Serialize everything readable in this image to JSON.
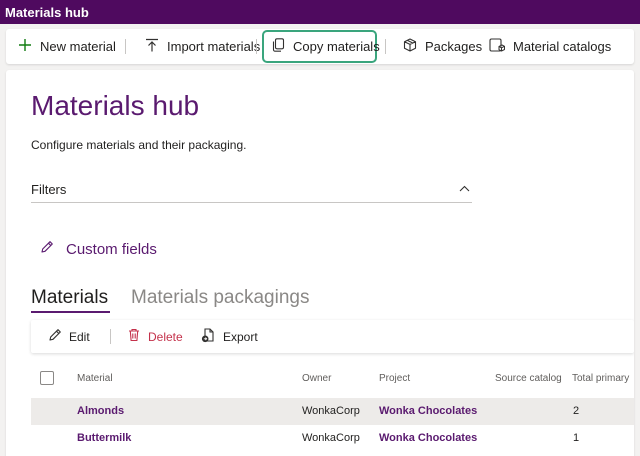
{
  "app": {
    "title": "Materials hub"
  },
  "toolbar": {
    "new_material": "New material",
    "import_materials": "Import materials",
    "copy_materials": "Copy materials",
    "packages": "Packages",
    "material_catalogs": "Material catalogs"
  },
  "page": {
    "title": "Materials hub",
    "subtitle": "Configure materials and their packaging.",
    "filters_label": "Filters",
    "custom_fields": "Custom fields"
  },
  "tabs": [
    {
      "label": "Materials",
      "active": true
    },
    {
      "label": "Materials packagings",
      "active": false
    }
  ],
  "subtoolbar": {
    "edit": "Edit",
    "delete": "Delete",
    "export": "Export"
  },
  "table": {
    "columns": [
      "Material",
      "Owner",
      "Project",
      "Source catalog",
      "Total primary"
    ],
    "rows": [
      {
        "material": "Almonds",
        "owner": "WonkaCorp",
        "project": "Wonka Chocolates",
        "source_catalog": "",
        "total_primary": "2"
      },
      {
        "material": "Buttermilk",
        "owner": "WonkaCorp",
        "project": "Wonka Chocolates",
        "source_catalog": "",
        "total_primary": "1"
      }
    ]
  },
  "colors": {
    "brand": "#4f0a5f",
    "accent": "#5a1a6f",
    "highlight": "#3aa57d",
    "danger": "#c4314b"
  }
}
